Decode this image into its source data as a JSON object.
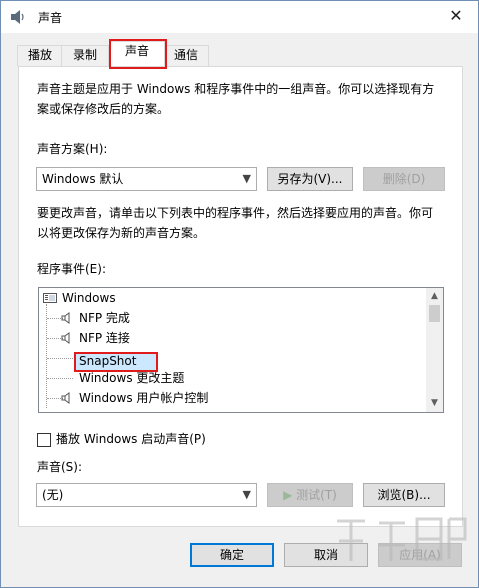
{
  "window": {
    "title": "声音",
    "close_glyph": "✕"
  },
  "tabs": [
    {
      "label": "播放"
    },
    {
      "label": "录制"
    },
    {
      "label": "声音"
    },
    {
      "label": "通信"
    }
  ],
  "panel": {
    "description": [
      "声音主题是应用于 Windows 和程序事件中的一组声音。你可以选择现有方",
      "案或保存修改后的方案。"
    ],
    "scheme_label": "声音方案(H):",
    "scheme_value": "Windows 默认",
    "save_as_label": "另存为(V)...",
    "delete_label": "删除(D)",
    "instructions": [
      "要更改声音，请单击以下列表中的程序事件，然后选择要应用的声音。你可",
      "以将更改保存为新的声音方案。"
    ],
    "events_label": "程序事件(E):",
    "events": [
      {
        "label": "Windows",
        "icon": "window-icon"
      },
      {
        "label": "NFP 完成",
        "icon": "speaker-icon"
      },
      {
        "label": "NFP 连接",
        "icon": "speaker-icon"
      },
      {
        "label": "SnapShot",
        "icon": "none",
        "selected": true
      },
      {
        "label": "Windows 更改主题",
        "icon": "none"
      },
      {
        "label": "Windows 用户帐户控制",
        "icon": "speaker-icon"
      }
    ],
    "startup_checkbox_label": "播放 Windows 启动声音(P)",
    "startup_checked": false,
    "sound_label": "声音(S):",
    "sound_value": "(无)",
    "test_label": "测试(T)",
    "browse_label": "浏览(B)..."
  },
  "footer": {
    "ok_label": "确定",
    "cancel_label": "取消",
    "apply_label": "应用(A)"
  },
  "colors": {
    "highlight_border": "#e01b1b",
    "selection": "#cce8ff",
    "accent": "#0078d7"
  }
}
